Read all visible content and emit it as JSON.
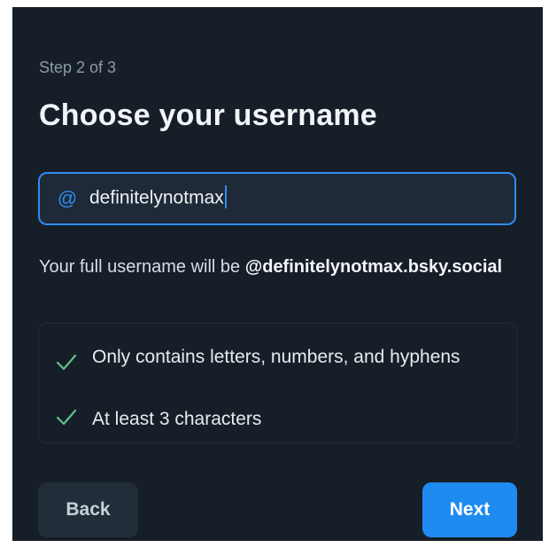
{
  "step_label": "Step 2 of 3",
  "title": "Choose your username",
  "username_input": {
    "at_symbol": "@",
    "value": "definitelynotmax"
  },
  "full_username": {
    "prefix": "Your full username will be ",
    "handle": "@definitelynotmax.bsky.social"
  },
  "requirements": [
    {
      "text": "Only contains letters, numbers, and hyphens",
      "status": "passed"
    },
    {
      "text": "At least 3 characters",
      "status": "passed"
    }
  ],
  "buttons": {
    "back": "Back",
    "next": "Next"
  },
  "colors": {
    "background": "#161e27",
    "accent": "#1f8bf0",
    "check": "#5fc18a"
  }
}
